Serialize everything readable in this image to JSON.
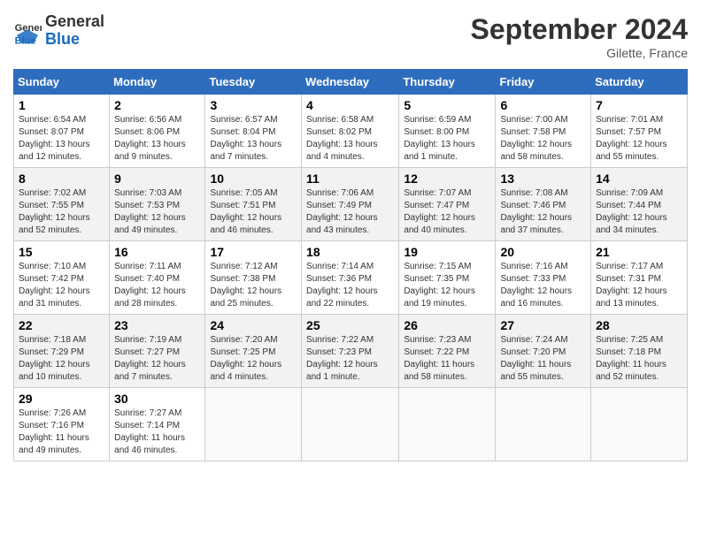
{
  "header": {
    "logo_general": "General",
    "logo_blue": "Blue",
    "month_title": "September 2024",
    "location": "Gilette, France"
  },
  "days_of_week": [
    "Sunday",
    "Monday",
    "Tuesday",
    "Wednesday",
    "Thursday",
    "Friday",
    "Saturday"
  ],
  "weeks": [
    [
      {
        "num": "1",
        "sunrise": "Sunrise: 6:54 AM",
        "sunset": "Sunset: 8:07 PM",
        "daylight": "Daylight: 13 hours and 12 minutes."
      },
      {
        "num": "2",
        "sunrise": "Sunrise: 6:56 AM",
        "sunset": "Sunset: 8:06 PM",
        "daylight": "Daylight: 13 hours and 9 minutes."
      },
      {
        "num": "3",
        "sunrise": "Sunrise: 6:57 AM",
        "sunset": "Sunset: 8:04 PM",
        "daylight": "Daylight: 13 hours and 7 minutes."
      },
      {
        "num": "4",
        "sunrise": "Sunrise: 6:58 AM",
        "sunset": "Sunset: 8:02 PM",
        "daylight": "Daylight: 13 hours and 4 minutes."
      },
      {
        "num": "5",
        "sunrise": "Sunrise: 6:59 AM",
        "sunset": "Sunset: 8:00 PM",
        "daylight": "Daylight: 13 hours and 1 minute."
      },
      {
        "num": "6",
        "sunrise": "Sunrise: 7:00 AM",
        "sunset": "Sunset: 7:58 PM",
        "daylight": "Daylight: 12 hours and 58 minutes."
      },
      {
        "num": "7",
        "sunrise": "Sunrise: 7:01 AM",
        "sunset": "Sunset: 7:57 PM",
        "daylight": "Daylight: 12 hours and 55 minutes."
      }
    ],
    [
      {
        "num": "8",
        "sunrise": "Sunrise: 7:02 AM",
        "sunset": "Sunset: 7:55 PM",
        "daylight": "Daylight: 12 hours and 52 minutes."
      },
      {
        "num": "9",
        "sunrise": "Sunrise: 7:03 AM",
        "sunset": "Sunset: 7:53 PM",
        "daylight": "Daylight: 12 hours and 49 minutes."
      },
      {
        "num": "10",
        "sunrise": "Sunrise: 7:05 AM",
        "sunset": "Sunset: 7:51 PM",
        "daylight": "Daylight: 12 hours and 46 minutes."
      },
      {
        "num": "11",
        "sunrise": "Sunrise: 7:06 AM",
        "sunset": "Sunset: 7:49 PM",
        "daylight": "Daylight: 12 hours and 43 minutes."
      },
      {
        "num": "12",
        "sunrise": "Sunrise: 7:07 AM",
        "sunset": "Sunset: 7:47 PM",
        "daylight": "Daylight: 12 hours and 40 minutes."
      },
      {
        "num": "13",
        "sunrise": "Sunrise: 7:08 AM",
        "sunset": "Sunset: 7:46 PM",
        "daylight": "Daylight: 12 hours and 37 minutes."
      },
      {
        "num": "14",
        "sunrise": "Sunrise: 7:09 AM",
        "sunset": "Sunset: 7:44 PM",
        "daylight": "Daylight: 12 hours and 34 minutes."
      }
    ],
    [
      {
        "num": "15",
        "sunrise": "Sunrise: 7:10 AM",
        "sunset": "Sunset: 7:42 PM",
        "daylight": "Daylight: 12 hours and 31 minutes."
      },
      {
        "num": "16",
        "sunrise": "Sunrise: 7:11 AM",
        "sunset": "Sunset: 7:40 PM",
        "daylight": "Daylight: 12 hours and 28 minutes."
      },
      {
        "num": "17",
        "sunrise": "Sunrise: 7:12 AM",
        "sunset": "Sunset: 7:38 PM",
        "daylight": "Daylight: 12 hours and 25 minutes."
      },
      {
        "num": "18",
        "sunrise": "Sunrise: 7:14 AM",
        "sunset": "Sunset: 7:36 PM",
        "daylight": "Daylight: 12 hours and 22 minutes."
      },
      {
        "num": "19",
        "sunrise": "Sunrise: 7:15 AM",
        "sunset": "Sunset: 7:35 PM",
        "daylight": "Daylight: 12 hours and 19 minutes."
      },
      {
        "num": "20",
        "sunrise": "Sunrise: 7:16 AM",
        "sunset": "Sunset: 7:33 PM",
        "daylight": "Daylight: 12 hours and 16 minutes."
      },
      {
        "num": "21",
        "sunrise": "Sunrise: 7:17 AM",
        "sunset": "Sunset: 7:31 PM",
        "daylight": "Daylight: 12 hours and 13 minutes."
      }
    ],
    [
      {
        "num": "22",
        "sunrise": "Sunrise: 7:18 AM",
        "sunset": "Sunset: 7:29 PM",
        "daylight": "Daylight: 12 hours and 10 minutes."
      },
      {
        "num": "23",
        "sunrise": "Sunrise: 7:19 AM",
        "sunset": "Sunset: 7:27 PM",
        "daylight": "Daylight: 12 hours and 7 minutes."
      },
      {
        "num": "24",
        "sunrise": "Sunrise: 7:20 AM",
        "sunset": "Sunset: 7:25 PM",
        "daylight": "Daylight: 12 hours and 4 minutes."
      },
      {
        "num": "25",
        "sunrise": "Sunrise: 7:22 AM",
        "sunset": "Sunset: 7:23 PM",
        "daylight": "Daylight: 12 hours and 1 minute."
      },
      {
        "num": "26",
        "sunrise": "Sunrise: 7:23 AM",
        "sunset": "Sunset: 7:22 PM",
        "daylight": "Daylight: 11 hours and 58 minutes."
      },
      {
        "num": "27",
        "sunrise": "Sunrise: 7:24 AM",
        "sunset": "Sunset: 7:20 PM",
        "daylight": "Daylight: 11 hours and 55 minutes."
      },
      {
        "num": "28",
        "sunrise": "Sunrise: 7:25 AM",
        "sunset": "Sunset: 7:18 PM",
        "daylight": "Daylight: 11 hours and 52 minutes."
      }
    ],
    [
      {
        "num": "29",
        "sunrise": "Sunrise: 7:26 AM",
        "sunset": "Sunset: 7:16 PM",
        "daylight": "Daylight: 11 hours and 49 minutes."
      },
      {
        "num": "30",
        "sunrise": "Sunrise: 7:27 AM",
        "sunset": "Sunset: 7:14 PM",
        "daylight": "Daylight: 11 hours and 46 minutes."
      },
      null,
      null,
      null,
      null,
      null
    ]
  ]
}
